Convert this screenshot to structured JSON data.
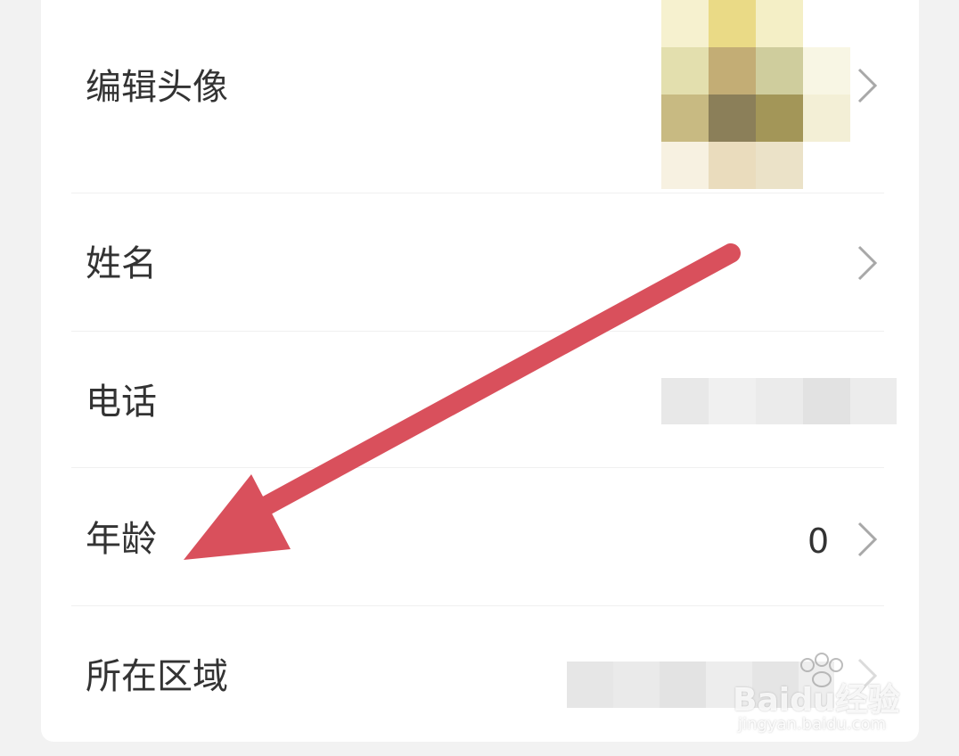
{
  "settings": {
    "items": [
      {
        "label": "编辑头像",
        "value": ""
      },
      {
        "label": "姓名",
        "value": ""
      },
      {
        "label": "电话",
        "value": ""
      },
      {
        "label": "年龄",
        "value": "0"
      },
      {
        "label": "所在区域",
        "value": ""
      }
    ]
  },
  "watermark": {
    "logo_text": "Baidu经验",
    "url_text": "jingyan.baidu.com"
  },
  "colors": {
    "arrow": "#d9505c",
    "chevron": "#a8a8a8",
    "label": "#333333"
  }
}
